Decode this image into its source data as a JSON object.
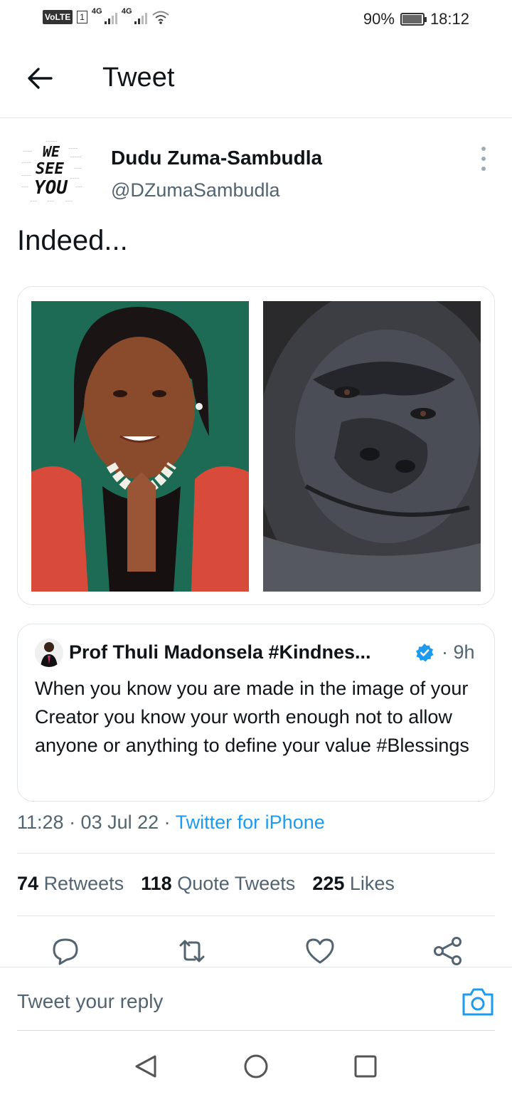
{
  "status_bar": {
    "volte": "VoLTE",
    "sim": "1",
    "net1": "4G",
    "net2": "4G",
    "battery": "90%",
    "battery_level": 0.9,
    "time": "18:12"
  },
  "header": {
    "title": "Tweet",
    "back_icon": "arrow-left-icon"
  },
  "tweet": {
    "author_name": "Dudu Zuma-Sambudla",
    "author_handle": "@DZumaSambudla",
    "avatar_text": [
      "WE",
      "SEE",
      "YOU"
    ],
    "text": "Indeed...",
    "media": [
      "woman-smiling-photo",
      "gorilla-photo"
    ]
  },
  "quote": {
    "name": "Prof Thuli Madonsela #Kindnes...",
    "time": "· 9h",
    "text": "When you know you are made in the image of your Creator you know your worth enough not to allow anyone or anything to define your value #Blessings",
    "verified_color": "#1d9bf0"
  },
  "meta": {
    "time": "11:28 · 03 Jul 22 · ",
    "source": "Twitter for iPhone"
  },
  "stats": {
    "retweets_count": "74",
    "retweets_label": "Retweets",
    "quotes_count": "118",
    "quotes_label": "Quote Tweets",
    "likes_count": "225",
    "likes_label": "Likes"
  },
  "actions": [
    "reply-icon",
    "retweet-icon",
    "like-icon",
    "share-icon"
  ],
  "reply_bar": {
    "placeholder": "Tweet your reply",
    "icon": "camera-icon"
  },
  "nav": [
    "back-triangle-icon",
    "home-circle-icon",
    "recents-square-icon"
  ],
  "colors": {
    "accent": "#1d9bf0",
    "text": "#0f1419",
    "secondary": "#536471"
  }
}
